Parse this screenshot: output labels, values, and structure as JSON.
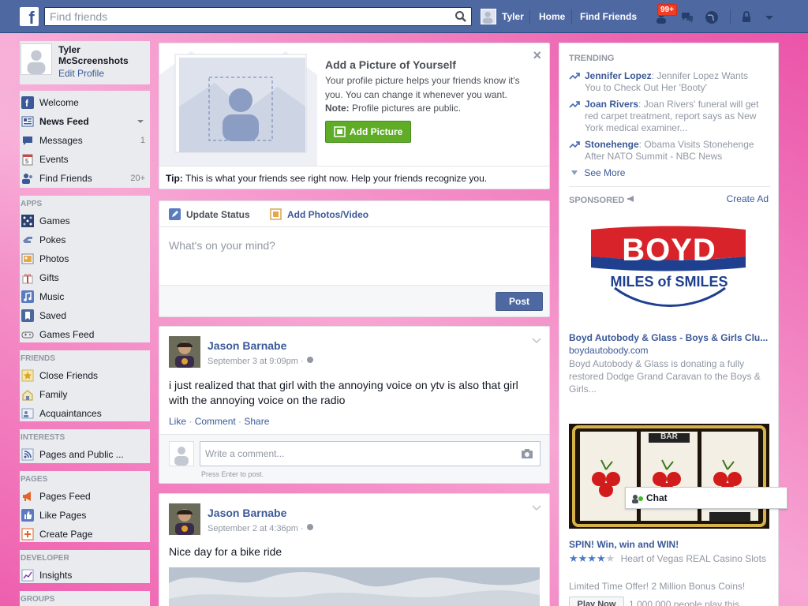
{
  "topbar": {
    "logo": "f",
    "search_placeholder": "Find friends",
    "user_name": "Tyler",
    "home": "Home",
    "find_friends": "Find Friends",
    "notif_count": "99+"
  },
  "profile": {
    "name": "Tyler McScreenshots",
    "edit": "Edit Profile"
  },
  "nav_main": [
    {
      "label": "Welcome",
      "icon": "welcome-icon",
      "count": ""
    },
    {
      "label": "News Feed",
      "icon": "news-feed-icon",
      "count": ""
    },
    {
      "label": "Messages",
      "icon": "messages-icon",
      "count": "1"
    },
    {
      "label": "Events",
      "icon": "events-icon",
      "count": ""
    },
    {
      "label": "Find Friends",
      "icon": "find-friends-icon",
      "count": "20+"
    }
  ],
  "apps": {
    "heading": "APPS",
    "items": [
      {
        "label": "Games",
        "icon": "games-icon"
      },
      {
        "label": "Pokes",
        "icon": "pokes-icon"
      },
      {
        "label": "Photos",
        "icon": "photos-icon"
      },
      {
        "label": "Gifts",
        "icon": "gifts-icon"
      },
      {
        "label": "Music",
        "icon": "music-icon"
      },
      {
        "label": "Saved",
        "icon": "saved-icon"
      },
      {
        "label": "Games Feed",
        "icon": "games-feed-icon"
      }
    ]
  },
  "friends": {
    "heading": "FRIENDS",
    "items": [
      {
        "label": "Close Friends",
        "icon": "star-icon"
      },
      {
        "label": "Family",
        "icon": "family-icon"
      },
      {
        "label": "Acquaintances",
        "icon": "acquaintances-icon"
      }
    ]
  },
  "interests": {
    "heading": "INTERESTS",
    "items": [
      {
        "label": "Pages and Public ...",
        "icon": "rss-icon"
      }
    ]
  },
  "pages": {
    "heading": "PAGES",
    "items": [
      {
        "label": "Pages Feed",
        "icon": "megaphone-icon"
      },
      {
        "label": "Like Pages",
        "icon": "thumbs-up-icon"
      },
      {
        "label": "Create Page",
        "icon": "create-page-icon"
      }
    ]
  },
  "developer": {
    "heading": "DEVELOPER",
    "items": [
      {
        "label": "Insights",
        "icon": "insights-icon"
      }
    ]
  },
  "groups": {
    "heading": "GROUPS"
  },
  "add_picture": {
    "title": "Add a Picture of Yourself",
    "body": "Your profile picture helps your friends know it's you. You can change it whenever you want.",
    "note_label": "Note:",
    "note": "Profile pictures are public.",
    "button": "Add Picture",
    "tip_label": "Tip:",
    "tip": "This is what your friends see right now. Help your friends recognize you.",
    "close": "×"
  },
  "composer": {
    "update_status": "Update Status",
    "add_photos": "Add Photos/Video",
    "placeholder": "What's on your mind?",
    "post": "Post"
  },
  "posts": [
    {
      "author": "Jason Barnabe",
      "time": "September 3 at 9:09pm · ",
      "text": "i just realized that that girl with the annoying voice on ytv is also that girl with the annoying voice on the radio",
      "like": "Like",
      "comment": "Comment",
      "share": "Share",
      "sep": " · ",
      "comment_placeholder": "Write a comment...",
      "press_enter": "Press Enter to post."
    },
    {
      "author": "Jason Barnabe",
      "time": "September 2 at 4:36pm · ",
      "text": "Nice day for a bike ride"
    }
  ],
  "trending": {
    "heading": "TRENDING",
    "items": [
      {
        "name": "Jennifer Lopez",
        "text": ": Jennifer Lopez Wants You to Check Out Her 'Booty'"
      },
      {
        "name": "Joan Rivers",
        "text": ": Joan Rivers' funeral will get red carpet treatment, report says as New York medical examiner..."
      },
      {
        "name": "Stonehenge",
        "text": ": Obama Visits Stonehenge After NATO Summit - NBC News"
      }
    ],
    "see_more": "See More"
  },
  "sponsored": {
    "heading": "SPONSORED",
    "create_ad": "Create Ad",
    "ad1": {
      "logo_top": "BOYD",
      "logo_bottom": "MILES of SMILES",
      "title": "Boyd Autobody & Glass - Boys & Girls Clu...",
      "url": "boydautobody.com",
      "desc": "Boyd Autobody & Glass is donating a fully restored Dodge Grand Caravan to the Boys & Girls..."
    },
    "ad2": {
      "slot_label": "BAR",
      "title": "SPIN! Win, win and WIN!",
      "rating_text": "Heart of Vegas REAL Casino Slots",
      "stars": 4,
      "desc": "Limited Time Offer! 2 Million Bonus Coins!",
      "play": "Play Now",
      "played": "1,000,000 people play this"
    }
  },
  "chat": {
    "label": "Chat"
  },
  "colors": {
    "brand": "#3b5998",
    "topbar": "#4e69a2",
    "add_picture_green": "#5fad27",
    "post_button": "#4e69a2",
    "background_pink": "#f28bc6"
  }
}
